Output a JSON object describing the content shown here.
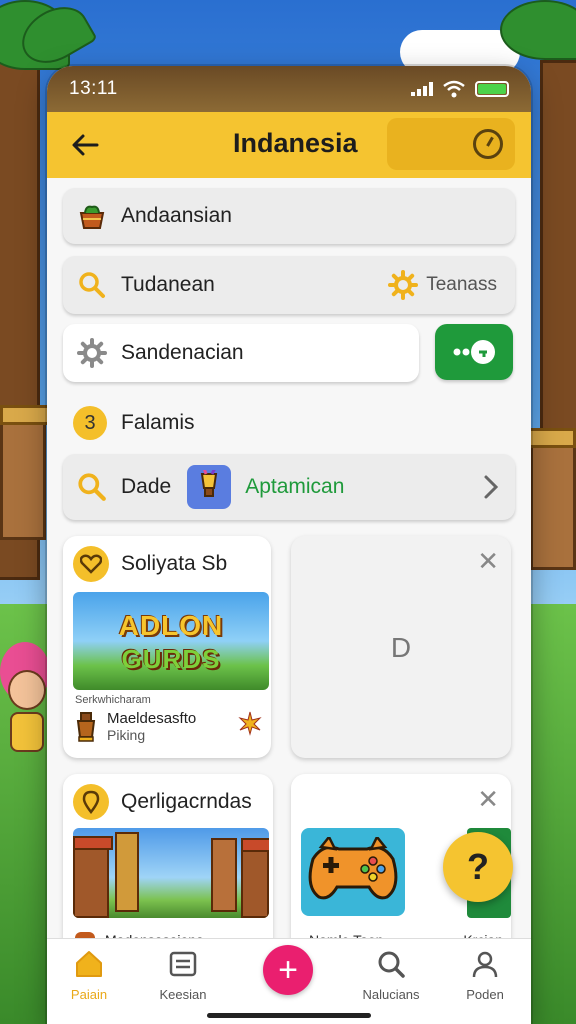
{
  "status_bar": {
    "time": "13:11"
  },
  "header": {
    "title": "Indanesia"
  },
  "rows": {
    "row1": {
      "label": "Andaansian"
    },
    "row2": {
      "label": "Tudanean",
      "right_label": "Teanass"
    },
    "row3": {
      "label": "Sandenacian"
    }
  },
  "section": {
    "number": "3",
    "label": "Falamis"
  },
  "row4": {
    "label": "Dade",
    "accent_label": "Aptamican"
  },
  "cards": {
    "card1": {
      "title": "Soliyata Sb",
      "thumb_title_line1": "ADLON",
      "thumb_title_line2": "GURDS",
      "caption": "Serkwhicharam",
      "item_name": "Maeldesasfto",
      "item_sub": "Piking"
    },
    "card2": {
      "center_mark": "D"
    },
    "card3": {
      "title": "Qerligacrndas",
      "footer": "Madonsasaiona"
    },
    "card4": {
      "footer_left": "Namle Taon",
      "footer_right": "Krcian"
    }
  },
  "help": {
    "label": "?"
  },
  "nav": {
    "items": [
      {
        "label": "Paiain",
        "icon": "home-icon"
      },
      {
        "label": "Keesian",
        "icon": "list-icon"
      },
      {
        "label": "Nalucians",
        "icon": "search-icon"
      },
      {
        "label": "Poden",
        "icon": "person-icon"
      }
    ],
    "add_label": "+"
  },
  "colors": {
    "accent": "#f5c430",
    "green": "#1f9a3b",
    "pink": "#ea1f6f"
  }
}
